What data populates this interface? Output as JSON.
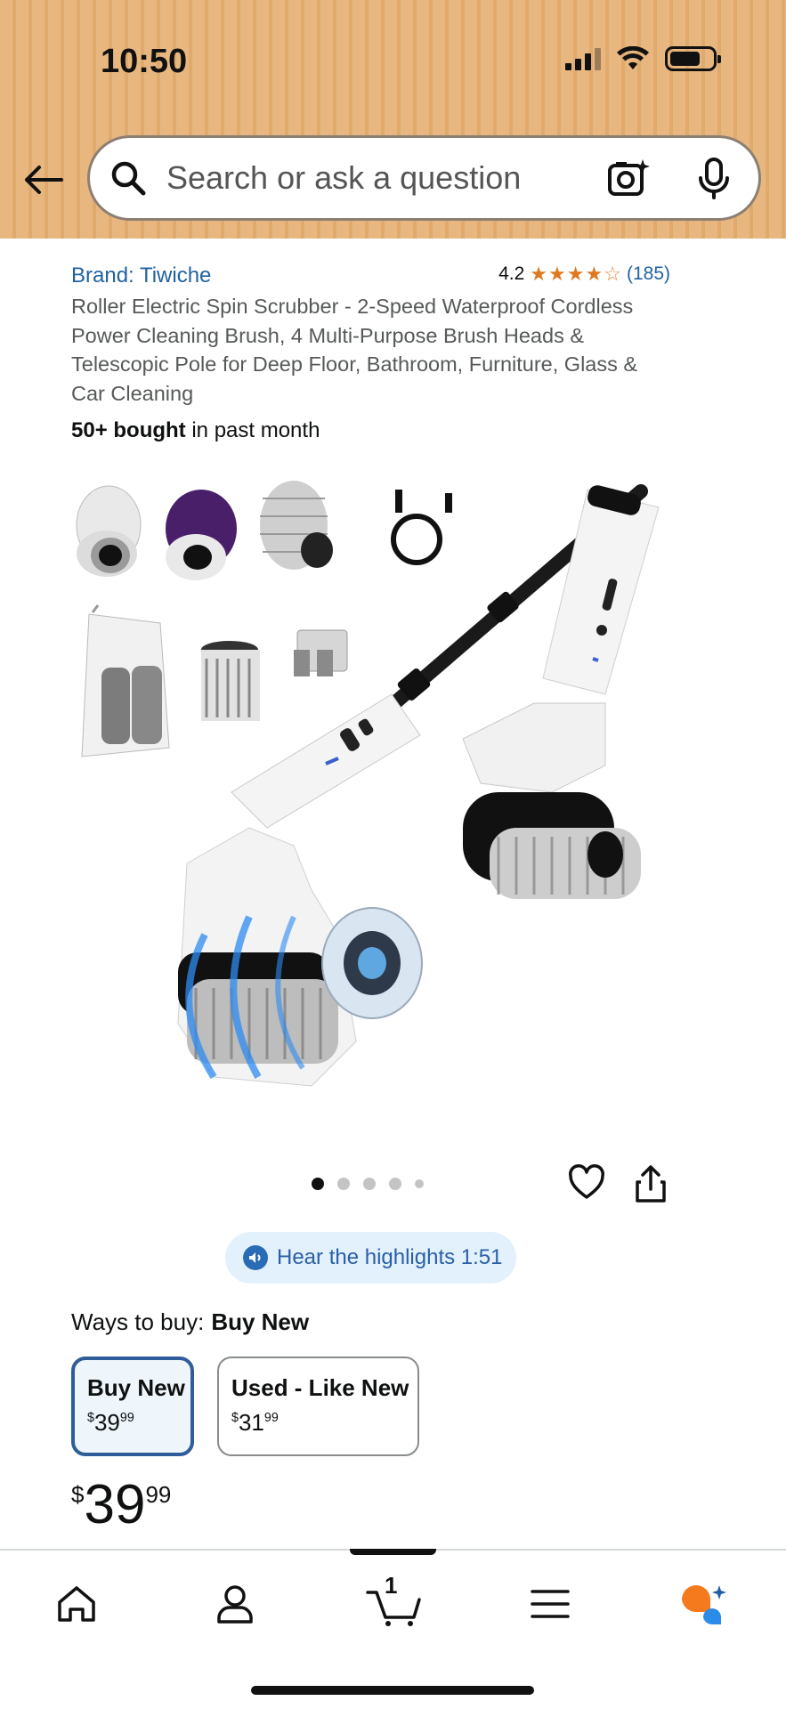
{
  "status_bar": {
    "time": "10:50"
  },
  "search": {
    "placeholder": "Search or ask a question"
  },
  "product": {
    "brand": "Brand: Tiwiche",
    "rating": "4.2",
    "rating_value": 4.2,
    "rating_count": "(185)",
    "title": "Roller Electric Spin Scrubber - 2-Speed Waterproof Cordless Power Cleaning Brush, 4 Multi-Purpose Brush Heads & Telescopic Pole for Deep Floor, Bathroom, Furniture, Glass & Car Cleaning",
    "bought_bold": "50+ bought",
    "bought_rest": " in past month"
  },
  "carousel": {
    "total": 5,
    "active_index": 0
  },
  "highlights": {
    "label": "Hear the highlights 1:51"
  },
  "ways_to_buy": {
    "label": "Ways to buy:",
    "selected": "Buy New",
    "options": [
      {
        "label": "Buy New",
        "dollars": "39",
        "cents": "99",
        "currency": "$"
      },
      {
        "label": "Used - Like New",
        "dollars": "31",
        "cents": "99",
        "currency": "$"
      }
    ]
  },
  "price": {
    "currency": "$",
    "dollars": "39",
    "cents": "99"
  },
  "nav": {
    "cart_count": "1",
    "items": [
      "home",
      "account",
      "cart",
      "menu",
      "rufus"
    ]
  },
  "colors": {
    "header_bg": "#e8b77f",
    "link": "#2162a1",
    "star": "#de7921",
    "selected_border": "#2f5d9a"
  }
}
